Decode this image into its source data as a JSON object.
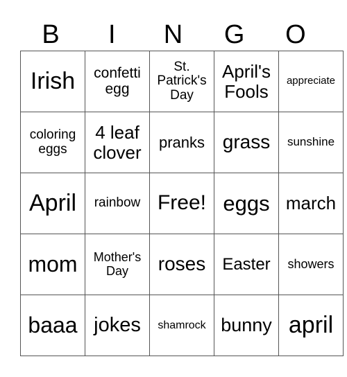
{
  "header": [
    "B",
    "I",
    "N",
    "G",
    "O"
  ],
  "cells": [
    [
      {
        "text": "Irish",
        "size": 34
      },
      {
        "text": "confetti egg",
        "size": 21
      },
      {
        "text": "St. Patrick's Day",
        "size": 19
      },
      {
        "text": "April's Fools",
        "size": 26
      },
      {
        "text": "appreciate",
        "size": 15
      }
    ],
    [
      {
        "text": "coloring eggs",
        "size": 19
      },
      {
        "text": "4 leaf clover",
        "size": 26
      },
      {
        "text": "pranks",
        "size": 22
      },
      {
        "text": "grass",
        "size": 28
      },
      {
        "text": "sunshine",
        "size": 17
      }
    ],
    [
      {
        "text": "April",
        "size": 34
      },
      {
        "text": "rainbow",
        "size": 19
      },
      {
        "text": "Free!",
        "size": 30
      },
      {
        "text": "eggs",
        "size": 31
      },
      {
        "text": "march",
        "size": 26
      }
    ],
    [
      {
        "text": "mom",
        "size": 32
      },
      {
        "text": "Mother's Day",
        "size": 18
      },
      {
        "text": "roses",
        "size": 28
      },
      {
        "text": "Easter",
        "size": 24
      },
      {
        "text": "showers",
        "size": 18
      }
    ],
    [
      {
        "text": "baaa",
        "size": 32
      },
      {
        "text": "jokes",
        "size": 29
      },
      {
        "text": "shamrock",
        "size": 16
      },
      {
        "text": "bunny",
        "size": 27
      },
      {
        "text": "april",
        "size": 34
      }
    ]
  ]
}
